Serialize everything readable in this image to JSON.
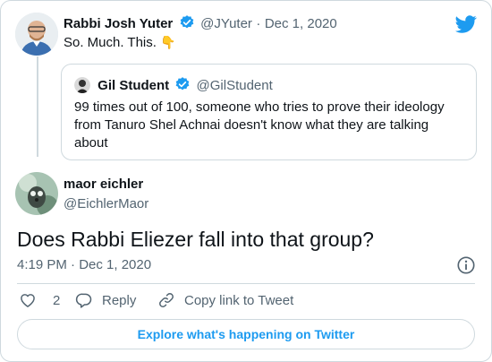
{
  "tweet": {
    "author_name": "Rabbi Josh Yuter",
    "author_handle": "@JYuter",
    "separator": "·",
    "date": "Dec 1, 2020",
    "text": "So. Much. This.",
    "emoji": "👇"
  },
  "quoted": {
    "author_name": "Gil Student",
    "author_handle": "@GilStudent",
    "text": "99 times out of 100, someone who tries to prove their ideology from Tanuro Shel Achnai doesn't know what they are talking about"
  },
  "reply": {
    "author_name": "maor eichler",
    "author_handle": "@EichlerMaor",
    "text": "Does Rabbi Eliezer fall into that group?",
    "timestamp": "4:19 PM · Dec 1, 2020"
  },
  "actions": {
    "like_count": "2",
    "reply_label": "Reply",
    "copy_label": "Copy link to Tweet"
  },
  "footer": {
    "explore_label": "Explore what's happening on Twitter"
  },
  "colors": {
    "brand_blue": "#1d9bf0",
    "muted": "#536471",
    "border": "#cfd9de"
  },
  "icons": [
    "twitter-bird-icon",
    "verified-badge-icon",
    "info-icon",
    "heart-icon",
    "reply-bubble-icon",
    "link-icon"
  ]
}
